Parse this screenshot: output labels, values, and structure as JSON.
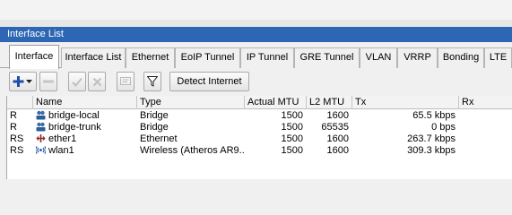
{
  "window": {
    "title": "Interface List"
  },
  "tabs": [
    "Interface",
    "Interface List",
    "Ethernet",
    "EoIP Tunnel",
    "IP Tunnel",
    "GRE Tunnel",
    "VLAN",
    "VRRP",
    "Bonding",
    "LTE"
  ],
  "toolbar": {
    "detect_internet_label": "Detect Internet"
  },
  "table": {
    "columns": [
      "Name",
      "Type",
      "Actual MTU",
      "L2 MTU",
      "Tx",
      "Rx"
    ],
    "rows": [
      {
        "flags": "R",
        "icon": "bridge-icon",
        "name": "bridge-local",
        "type": "Bridge",
        "actual_mtu": "1500",
        "l2_mtu": "1600",
        "tx": "65.5 kbps"
      },
      {
        "flags": "R",
        "icon": "bridge-icon",
        "name": "bridge-trunk",
        "type": "Bridge",
        "actual_mtu": "1500",
        "l2_mtu": "65535",
        "tx": "0 bps"
      },
      {
        "flags": "RS",
        "icon": "ethernet-icon",
        "name": "ether1",
        "type": "Ethernet",
        "actual_mtu": "1500",
        "l2_mtu": "1600",
        "tx": "263.7 kbps"
      },
      {
        "flags": "RS",
        "icon": "wireless-icon",
        "name": "wlan1",
        "type": "Wireless (Atheros AR9...",
        "actual_mtu": "1500",
        "l2_mtu": "1600",
        "tx": "309.3 kbps"
      }
    ]
  }
}
